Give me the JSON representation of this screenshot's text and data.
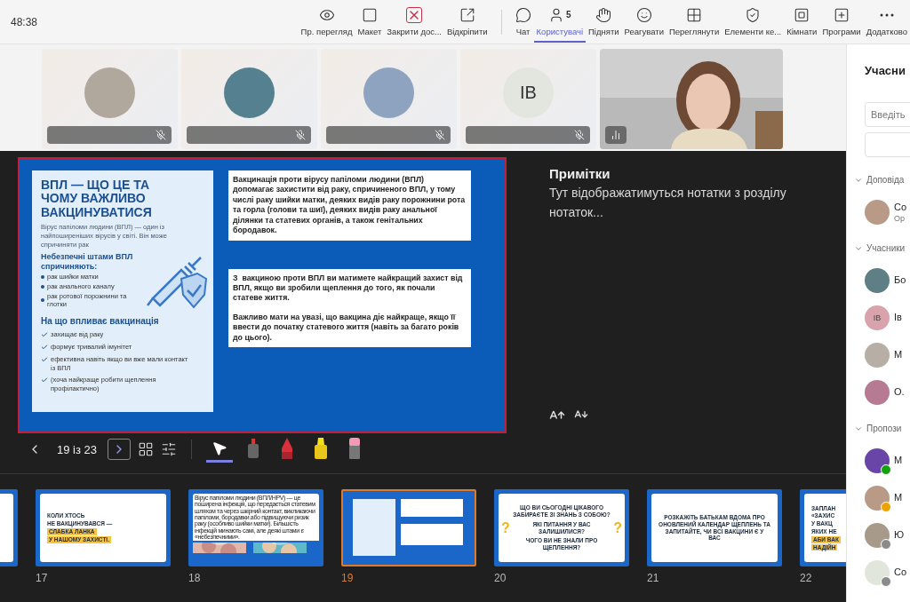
{
  "top_bar": {
    "timer": "48:38",
    "buttons": [
      {
        "label": "Пр. перегляд",
        "selected": false
      },
      {
        "label": "Макет",
        "selected": false
      },
      {
        "label": "Закрити дос...",
        "selected": false
      },
      {
        "label": "Відкріпити",
        "selected": false
      },
      {
        "label": "Чат",
        "selected": false
      },
      {
        "label": "Користувачі",
        "badge": "5",
        "selected": true
      },
      {
        "label": "Підняти",
        "selected": false
      },
      {
        "label": "Реагувати",
        "selected": false
      },
      {
        "label": "Переглянути",
        "selected": false
      },
      {
        "label": "Елементи ке...",
        "selected": false
      },
      {
        "label": "Кімнати",
        "selected": false
      },
      {
        "label": "Програми",
        "selected": false
      },
      {
        "label": "Додатково",
        "selected": false
      }
    ]
  },
  "video_tiles": [
    {
      "kind": "avatar",
      "muted": true
    },
    {
      "kind": "avatar",
      "muted": true
    },
    {
      "kind": "avatar",
      "muted": true
    },
    {
      "kind": "initials",
      "initials": "IB",
      "muted": true
    },
    {
      "kind": "video"
    }
  ],
  "slide": {
    "card": {
      "title": "ВПЛ — ЩО ЦЕ ТА ЧОМУ ВАЖЛИВО ВАКЦИНУВАТИСЯ",
      "intro": "Вірус папіломи людини (ВПЛ) — один із найпоширеніших вірусів у світі. Він може спричиняти рак",
      "risks_heading": "Небезпечні штами ВПЛ спричиняють:",
      "risks": [
        "рак шийки матки",
        "рак анального каналу",
        "рак ротової порожнини та глотки"
      ],
      "effects_heading": "На що впливає вакцинація",
      "effects": [
        "захищає від раку",
        "формує тривалий імунітет",
        "ефективна навіть якщо ви вже мали контакт із ВПЛ",
        "(хоча найкраще робити щеплення профілактично)"
      ]
    },
    "boxes": [
      [
        "Вакцинація проти вірусу папіломи людини (ВПЛ) допомагає захистити від раку, спричиненого ВПЛ, у тому числі раку шийки матки, деяких видів раку порожнини рота та горла (голови та шиї), деяких видів раку анальної ділянки та статевих органів, а також генітальних бородавок."
      ],
      [
        "З  вакциною проти ВПЛ ви матимете найкращий захист від ВПЛ, якщо ви зробили щеплення до того, як почали статеве життя.",
        "Важливо мати на увазі, що вакцина діє найкраще, якщо її ввести до початку статевого життя (навіть за багато років до цього)."
      ]
    ]
  },
  "notes": {
    "title": "Примітки",
    "text": "Тут відображатимуться нотатки з розділу нотаток..."
  },
  "presenter_controls": {
    "counter": "19 із 23",
    "tools": [
      {
        "selected": true
      },
      {
        "selected": false
      },
      {
        "selected": false
      },
      {
        "selected": false
      },
      {
        "selected": false
      }
    ]
  },
  "thumbnails": [
    {
      "kind": "cropped",
      "selected": false
    },
    {
      "kind": "title",
      "number": "17",
      "selected": false,
      "lines": [
        {
          "text": "КОЛИ ХТОСЬ",
          "highlight": false
        },
        {
          "text": "НЕ ВАКЦИНУВАВСЯ —",
          "highlight": false
        },
        {
          "text": "СЛАБКА ЛАНКА",
          "highlight": true
        },
        {
          "text": "У НАШОМУ ЗАХИСТІ.",
          "highlight": true
        }
      ]
    },
    {
      "kind": "text-photos",
      "number": "18",
      "selected": false,
      "text": "Вірус папіломи людини (ВПЛ/HPV) — це поширена інфекція, що передається статевим шляхом та через шкірний контакт, викликаючи папіломи, бородавки або підвищуючи ризик раку (особливо шийки матки). Більшість інфекцій минають самі, але деякі штами є «небезпечними»."
    },
    {
      "kind": "mini-slide",
      "number": "19",
      "selected": true
    },
    {
      "kind": "questions",
      "number": "20",
      "selected": false,
      "lines": [
        "ЩО ВИ СЬОГОДНІ ЦІКАВОГО ЗАБИРАЄТЕ ЗІ ЗНАНЬ З СОБОЮ?",
        "ЯКІ ПИТАННЯ У ВАС ЗАЛИШИЛИСЯ?",
        "ЧОГО ВИ НЕ ЗНАЛИ ПРО ЩЕПЛЕННЯ?"
      ],
      "marks": [
        "?",
        "?"
      ]
    },
    {
      "kind": "statement",
      "number": "21",
      "selected": false,
      "text": "РОЗКАЖІТЬ БАТЬКАМ ВДОМА ПРО ОНОВЛЕНИЙ КАЛЕНДАР ЩЕПЛЕНЬ ТА ЗАПИТАЙТЕ, ЧИ ВСІ ВАКЦИНИ Є У ВАС"
    },
    {
      "kind": "title",
      "number": "22",
      "selected": false,
      "lines": [
        {
          "text": "ЗАПЛАН",
          "highlight": false
        },
        {
          "text": "«ЗАХИС",
          "highlight": false
        },
        {
          "text": "У ВАКЦ",
          "highlight": false
        },
        {
          "text": "ЯКИХ НЕ",
          "highlight": false
        },
        {
          "text": "АБИ ВАК",
          "highlight": true
        },
        {
          "text": "НАДІЙН",
          "highlight": true
        }
      ]
    }
  ],
  "participants_panel": {
    "title": "Учасни",
    "search": {
      "placeholder": "Введіть"
    },
    "sections": [
      {
        "label": "Доповіда",
        "expanded": true,
        "people": [
          {
            "name": "Со",
            "role": "Ор"
          }
        ]
      },
      {
        "label": "Учасники",
        "expanded": true,
        "people": [
          {
            "name": "Бо"
          },
          {
            "name": "Ів",
            "initials": "IB"
          },
          {
            "name": "М"
          },
          {
            "name": "О."
          }
        ]
      },
      {
        "label": "Пропози",
        "expanded": true,
        "people": [
          {
            "name": "М",
            "color": "#13a10e"
          },
          {
            "name": "М",
            "color": "#eaa300"
          },
          {
            "name": "Ю",
            "color": "#8a8a8a"
          },
          {
            "name": "Со",
            "color": "#8a8a8a"
          }
        ]
      }
    ]
  }
}
